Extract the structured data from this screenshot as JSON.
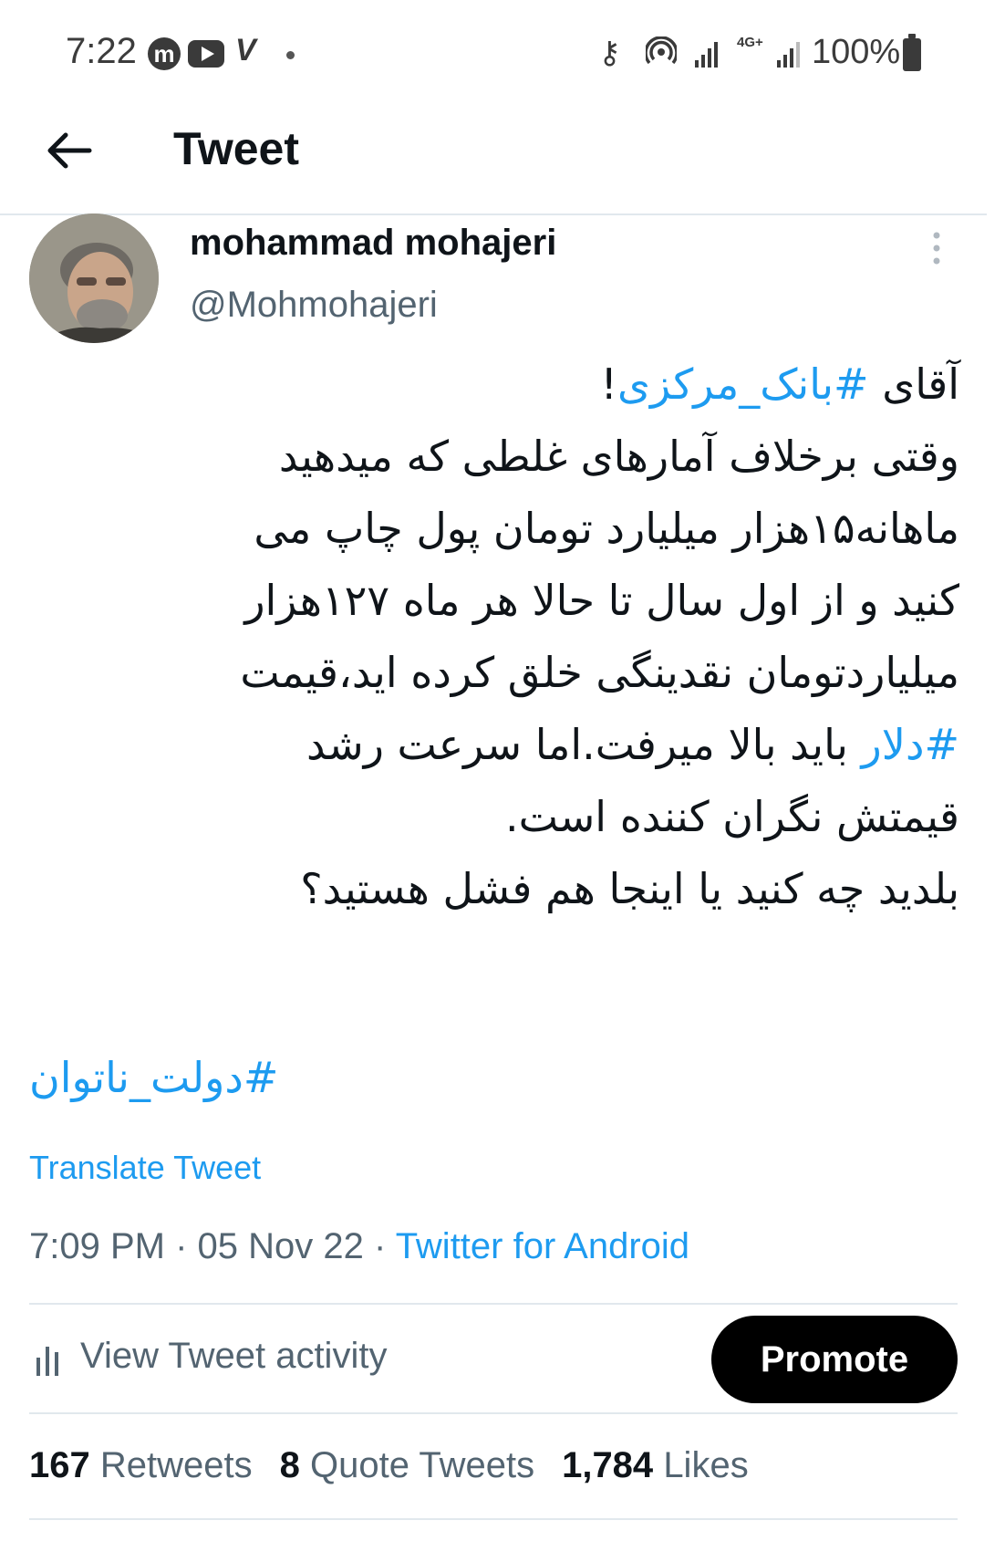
{
  "status_bar": {
    "time": "7:22",
    "network": "4G+",
    "battery": "100%",
    "icons": [
      "m-app-icon",
      "youtube-icon",
      "v-app-icon",
      "dot-icon",
      "key-icon",
      "hotspot-icon",
      "signal-icon",
      "signal-icon",
      "battery-icon"
    ]
  },
  "header": {
    "title": "Tweet"
  },
  "author": {
    "name": "mohammad mohajeri",
    "handle": "@Mohmohajeri"
  },
  "tweet": {
    "l1_text": "آقای ",
    "l1_tag": "#بانک_مرکزی",
    "l1_end": "!",
    "l2": "وقتی برخلاف آمارهای غلطی که میدهید",
    "l3": "ماهانه۱۵هزار میلیارد تومان پول چاپ می",
    "l4": "کنید و از اول سال تا حالا هر ماه ۱۲۷هزار",
    "l5": "میلیاردتومان نقدینگی خلق کرده اید،قیمت",
    "l6_tag": "#دلار",
    "l6_text": " باید بالا میرفت.اما سرعت رشد",
    "l7": "قیمتش نگران کننده است.",
    "l8": "بلدید چه کنید یا اینجا هم فشل هستید؟",
    "tag_line": "#دولت_ناتوان"
  },
  "translate_label": "Translate Tweet",
  "meta": {
    "time": "7:09 PM",
    "sep": " · ",
    "date": "05 Nov 22",
    "source": "Twitter for Android"
  },
  "activity_label": "View Tweet activity",
  "promote_label": "Promote",
  "stats": {
    "retweets_count": "167",
    "retweets_label": "Retweets",
    "quotes_count": "8",
    "quotes_label": "Quote Tweets",
    "likes_count": "1,784",
    "likes_label": "Likes"
  },
  "colors": {
    "accent": "#1d9bf0",
    "text": "#0f1419",
    "secondary": "#536471"
  }
}
